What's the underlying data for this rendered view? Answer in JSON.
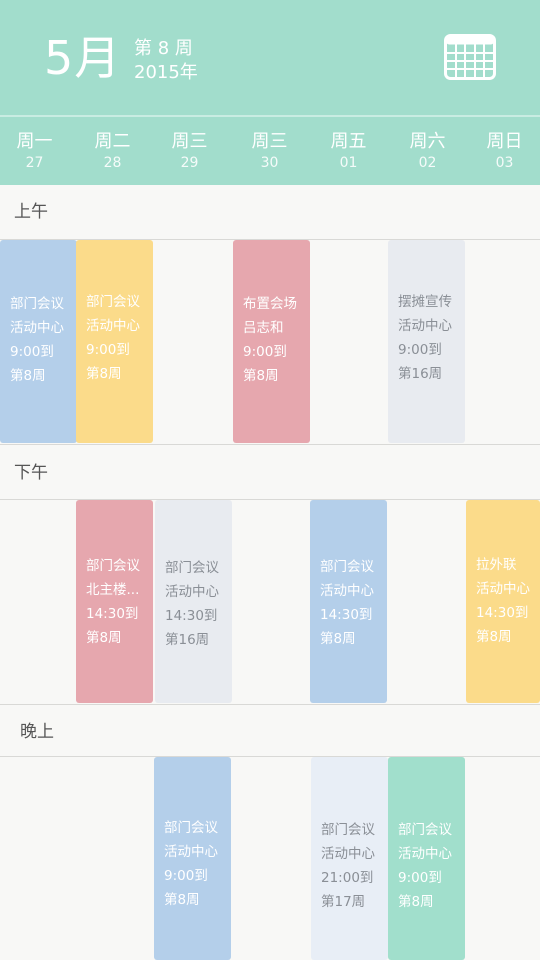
{
  "header": {
    "month": "5月",
    "week": "第 8 周",
    "year": "2015年"
  },
  "days": [
    {
      "name": "周一",
      "date": "27"
    },
    {
      "name": "周二",
      "date": "28"
    },
    {
      "name": "周三",
      "date": "29"
    },
    {
      "name": "周三",
      "date": "30"
    },
    {
      "name": "周五",
      "date": "01"
    },
    {
      "name": "周六",
      "date": "02"
    },
    {
      "name": "周日",
      "date": "03"
    }
  ],
  "sections": {
    "morning": "上午",
    "afternoon": "下午",
    "evening": "晚上"
  },
  "events": {
    "m_mon": {
      "title": "部门会议",
      "place": "活动中心",
      "time": "9:00到",
      "week": "第8周"
    },
    "m_tue": {
      "title": "部门会议",
      "place": "活动中心",
      "time": "9:00到",
      "week": "第8周"
    },
    "m_thu": {
      "title": "布置会场",
      "place": "吕志和",
      "time": "9:00到",
      "week": "第8周"
    },
    "m_sat": {
      "title": "摆摊宣传",
      "place": "活动中心",
      "time": "9:00到",
      "week": "第16周"
    },
    "a_tue": {
      "title": "部门会议",
      "place": "北主楼...",
      "time": "14:30到",
      "week": "第8周"
    },
    "a_wed": {
      "title": "部门会议",
      "place": "活动中心",
      "time": "14:30到",
      "week": "第16周"
    },
    "a_fri": {
      "title": "部门会议",
      "place": "活动中心",
      "time": "14:30到",
      "week": "第8周"
    },
    "a_sun": {
      "title": "拉外联",
      "place": "活动中心",
      "time": "14:30到",
      "week": "第8周"
    },
    "e_wed": {
      "title": "部门会议",
      "place": "活动中心",
      "time": "9:00到",
      "week": "第8周"
    },
    "e_fri": {
      "title": "部门会议",
      "place": "活动中心",
      "time": "21:00到",
      "week": "第17周"
    },
    "e_sat": {
      "title": "部门会议",
      "place": "活动中心",
      "time": "9:00到",
      "week": "第8周"
    }
  },
  "icons": {
    "calendar": "calendar-grid-icon"
  },
  "colors": {
    "header": "#a2ddcc",
    "blue": "#b4cfea",
    "yellow": "#fbdb8a",
    "pink": "#e6a7ae",
    "gray": "#e8ebf0",
    "green": "#a1dfcc"
  }
}
